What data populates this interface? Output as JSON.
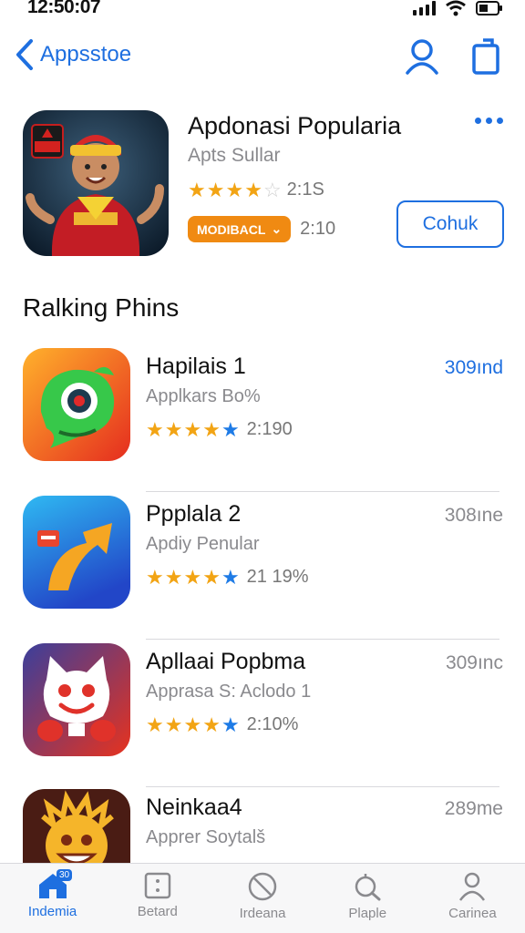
{
  "status_bar": {
    "time": "12:50:07"
  },
  "nav": {
    "back_label": "Appsstoe"
  },
  "featured": {
    "title": "Apdonasi Popularia",
    "subtitle": "Apts Sullar",
    "rating_text": "2:1S",
    "stars": 4,
    "badge_label": "MODIBACL",
    "badge_value": "2:10",
    "button_label": "Cohuk"
  },
  "section_title": "Ralking Phins",
  "apps": [
    {
      "name": "Hapilais 1",
      "subtitle": "Applkars Bo%",
      "rating_text": "2:190",
      "price": "309ınd",
      "price_highlight": true
    },
    {
      "name": "Ppplala 2",
      "subtitle": "Apdiy Penular",
      "rating_text": "21 19%",
      "price": "308ıne",
      "price_highlight": false
    },
    {
      "name": "Apllaai Popbma",
      "subtitle": "Apprasa S: Aclodo 1",
      "rating_text": "2:10%",
      "price": "309ınc",
      "price_highlight": false
    },
    {
      "name": "Neinkaa4",
      "subtitle": "Apprer Soytalš",
      "rating_text": "",
      "price": "289me",
      "price_highlight": false
    }
  ],
  "tabs": [
    {
      "label": "Indemia",
      "icon": "home-icon",
      "active": true,
      "badge": "30"
    },
    {
      "label": "Betard",
      "icon": "grid-icon",
      "active": false
    },
    {
      "label": "Irdeana",
      "icon": "no-entry-icon",
      "active": false
    },
    {
      "label": "Plaple",
      "icon": "search-icon",
      "active": false
    },
    {
      "label": "Carinea",
      "icon": "person-icon",
      "active": false
    }
  ],
  "colors": {
    "accent": "#1e6fe0",
    "star": "#f2a414",
    "badge": "#f08a12"
  }
}
